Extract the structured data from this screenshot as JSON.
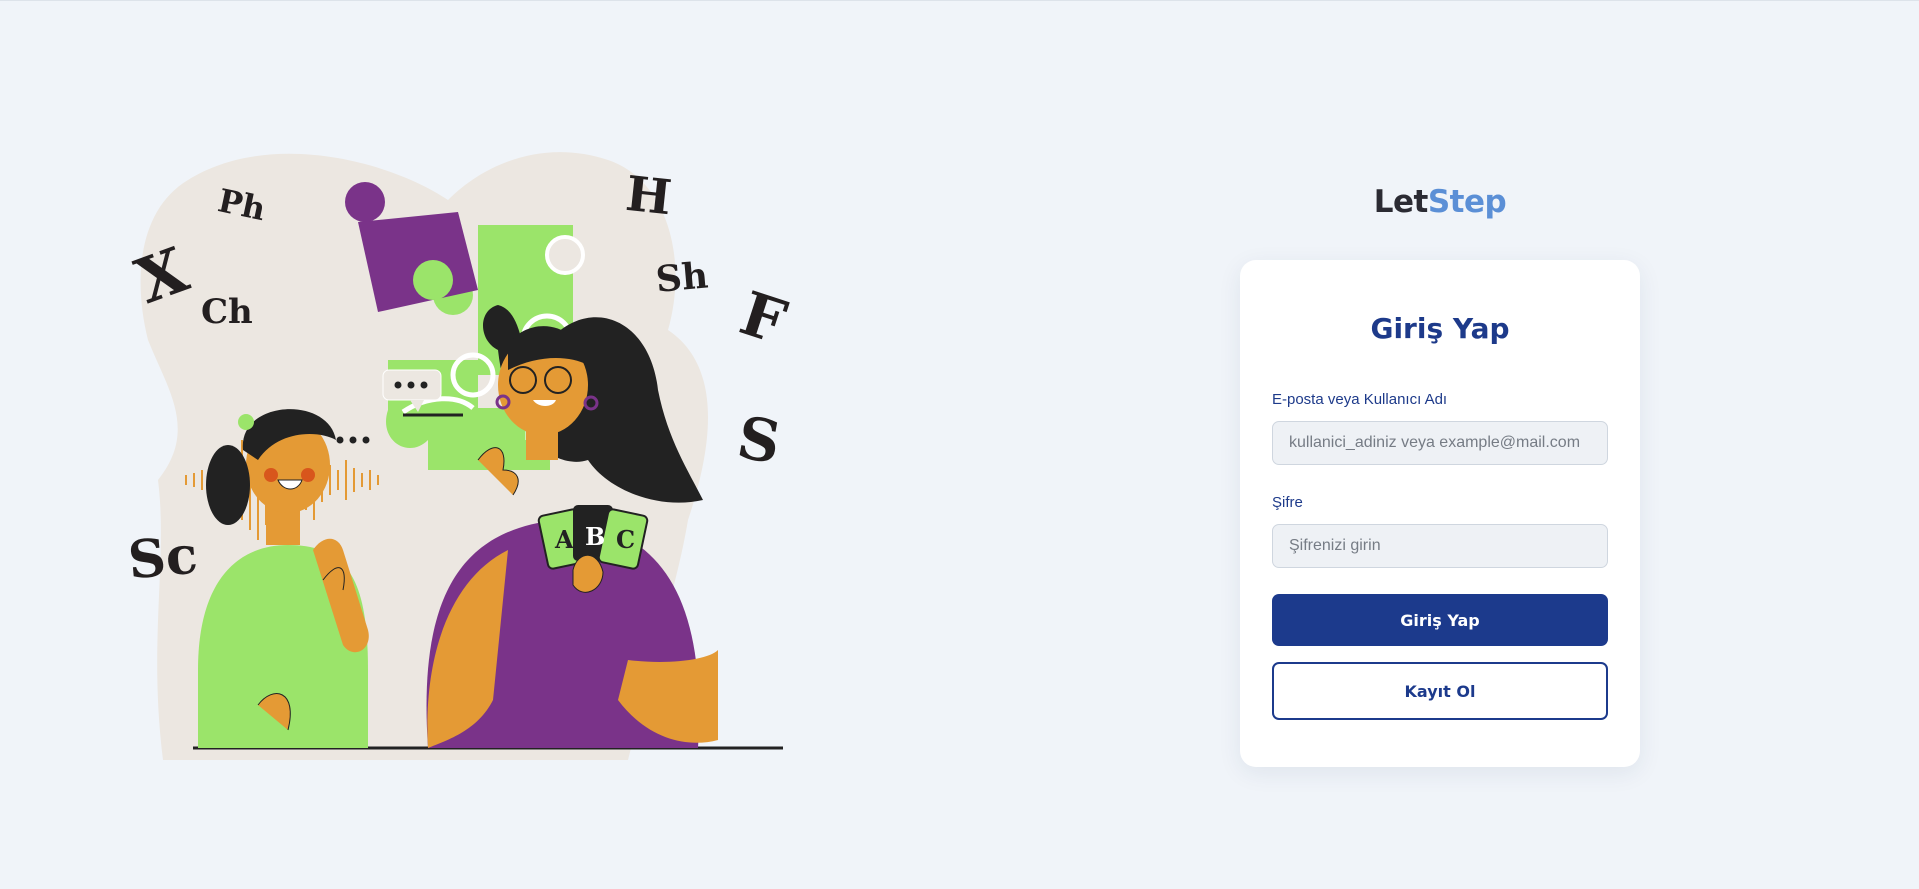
{
  "brand": {
    "part1": "Let",
    "part2": "Step"
  },
  "illustration": {
    "letters": [
      "X",
      "Ph",
      "Ch",
      "H",
      "Sh",
      "F",
      "S",
      "Sc"
    ],
    "cards": [
      "A",
      "B",
      "C"
    ]
  },
  "login": {
    "title": "Giriş Yap",
    "email_label": "E-posta veya Kullanıcı Adı",
    "email_placeholder": "kullanici_adiniz veya example@mail.com",
    "password_label": "Şifre",
    "password_placeholder": "Şifrenizi girin",
    "submit_label": "Giriş Yap",
    "register_label": "Kayıt Ol"
  },
  "colors": {
    "background": "#f0f4f9",
    "primary": "#1c3a8c",
    "brand_accent": "#5b8fd6",
    "illustration_green": "#9be46a",
    "illustration_purple": "#7a3389",
    "illustration_orange": "#e49a35"
  }
}
